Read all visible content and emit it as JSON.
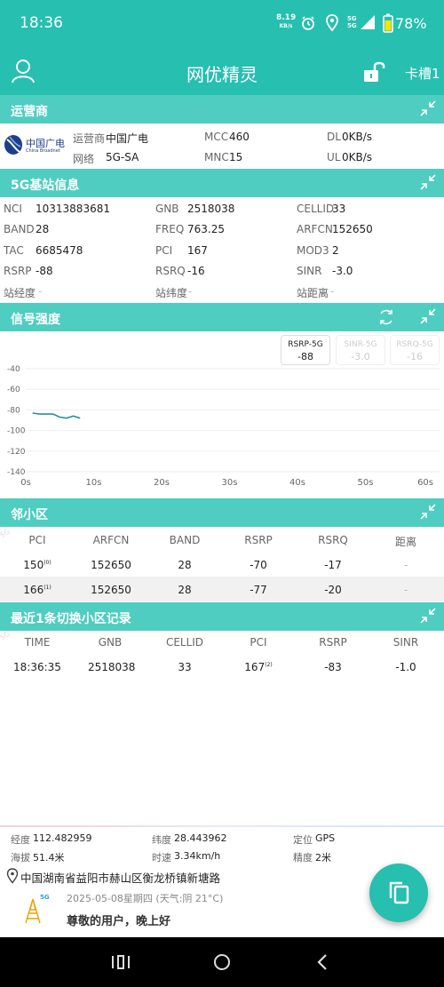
{
  "status_bar": {
    "time": "18:36",
    "net_speed_top": "8.19",
    "net_speed_unit": "KB/s",
    "sim_tags": "5G\n5G",
    "battery": "78%"
  },
  "app_bar": {
    "title": "网优精灵",
    "slot": "卡槽1",
    "icons": [
      "user-icon",
      "unlock-icon"
    ]
  },
  "operator": {
    "section_title": "运营商",
    "logo_name": "中国广电",
    "logo_sub": "China Broadnet",
    "operator_label": "运营商",
    "operator_value": "中国广电",
    "network_label": "网络",
    "network_value": "5G-SA",
    "mcc_label": "MCC",
    "mcc_value": "460",
    "mnc_label": "MNC",
    "mnc_value": "15",
    "dl_label": "DL",
    "dl_value": "0KB/s",
    "ul_label": "UL",
    "ul_value": "0KB/s"
  },
  "bs5g": {
    "section_title": "5G基站信息",
    "nci_label": "NCI",
    "nci_value": "10313883681",
    "gnb_label": "GNB",
    "gnb_value": "2518038",
    "cellid_label": "CELLID",
    "cellid_value": "33",
    "band_label": "BAND",
    "band_value": "28",
    "freq_label": "FREQ",
    "freq_value": "763.25",
    "arfcn_label": "ARFCN",
    "arfcn_value": "152650",
    "tac_label": "TAC",
    "tac_value": "6685478",
    "pci_label": "PCI",
    "pci_value": "167",
    "mod3_label": "MOD3",
    "mod3_value": "2",
    "rsrp_label": "RSRP",
    "rsrp_value": "-88",
    "rsrq_label": "RSRQ",
    "rsrq_value": "-16",
    "sinr_label": "SINR",
    "sinr_value": "-3.0",
    "lon_label": "站经度",
    "lon_value": "-",
    "lat_label": "站纬度",
    "lat_value": "-",
    "dist_label": "站距离",
    "dist_value": "-"
  },
  "signal": {
    "section_title": "信号强度",
    "tabs": [
      {
        "label": "RSRP-5G",
        "value": "-88",
        "active": true
      },
      {
        "label": "SINR-5G",
        "value": "-3.0",
        "active": false
      },
      {
        "label": "RSRQ-5G",
        "value": "-16",
        "active": false
      }
    ]
  },
  "chart_data": {
    "type": "line",
    "title": "",
    "xlabel": "",
    "ylabel": "",
    "xlim": [
      0,
      60
    ],
    "ylim": [
      -140,
      -40
    ],
    "x_ticks": [
      "0s",
      "10s",
      "20s",
      "30s",
      "40s",
      "50s",
      "60s"
    ],
    "y_ticks": [
      "-40",
      "-60",
      "-80",
      "-100",
      "-120",
      "-140"
    ],
    "series": [
      {
        "color": "#2a8f9c",
        "x": [
          1,
          2,
          3,
          4,
          5,
          6,
          7,
          8
        ],
        "y": [
          -83,
          -84,
          -84,
          -84,
          -87,
          -88,
          -86,
          -88
        ]
      }
    ],
    "grid": true
  },
  "neighbors": {
    "section_title": "邻小区",
    "watermark": "5G",
    "columns": [
      "PCI",
      "ARFCN",
      "BAND",
      "RSRP",
      "RSRQ",
      "距离"
    ],
    "rows": [
      {
        "pci": "150",
        "sup": "(0)",
        "arfcn": "152650",
        "band": "28",
        "rsrp": "-70",
        "rsrq": "-17",
        "dist": "-"
      },
      {
        "pci": "166",
        "sup": "(1)",
        "arfcn": "152650",
        "band": "28",
        "rsrp": "-77",
        "rsrq": "-20",
        "dist": "-"
      }
    ]
  },
  "handover": {
    "section_title": "最近1条切换小区记录",
    "watermark": "5G",
    "columns": [
      "TIME",
      "GNB",
      "CELLID",
      "PCI",
      "RSRP",
      "SINR"
    ],
    "rows": [
      {
        "time": "18:36:35",
        "gnb": "2518038",
        "cellid": "33",
        "pci": "167",
        "sup": "(2)",
        "rsrp": "-83",
        "sinr": "-1.0"
      }
    ]
  },
  "location": {
    "lon_label": "经度",
    "lon_value": "112.482959",
    "lat_label": "纬度",
    "lat_value": "28.443962",
    "pos_label": "定位",
    "pos_value": "GPS",
    "alt_label": "海拔",
    "alt_value": "51.4米",
    "speed_label": "时速",
    "speed_value": "3.34km/h",
    "acc_label": "精度",
    "acc_value": "2米",
    "address": "中国湖南省益阳市赫山区衡龙桥镇新塘路"
  },
  "footer": {
    "tower_tag": "5G",
    "date_weather": "2025-05-08星期四 (天气:阴 21°C)",
    "greeting": "尊敬的用户，晚上好"
  },
  "colors": {
    "primary": "#26bfb0",
    "section": "#4ecdc0",
    "line": "#2a8f9c"
  }
}
